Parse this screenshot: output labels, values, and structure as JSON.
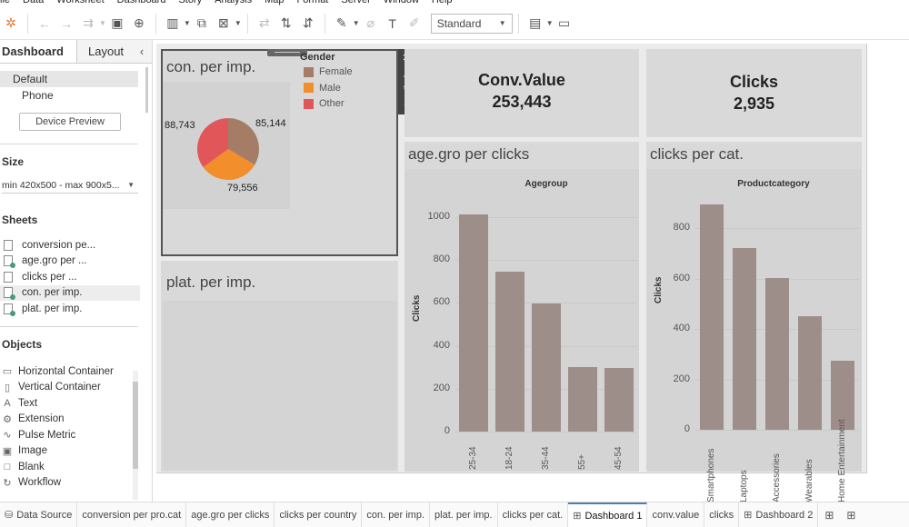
{
  "menu": [
    "ile",
    "Data",
    "Worksheet",
    "Dashboard",
    "Story",
    "Analysis",
    "Map",
    "Format",
    "Server",
    "Window",
    "Help"
  ],
  "toolbar": {
    "fit_select": "Standard"
  },
  "sidebar": {
    "tabs": {
      "dashboard": "Dashboard",
      "layout": "Layout"
    },
    "devices": [
      "Default",
      "Phone"
    ],
    "device_preview": "Device Preview",
    "size_title": "Size",
    "size_value": "min 420x500 - max 900x5...",
    "sheets_title": "Sheets",
    "sheets": [
      {
        "label": "conversion pe...",
        "used": false
      },
      {
        "label": "age.gro per ...",
        "used": true
      },
      {
        "label": "clicks per ...",
        "used": false
      },
      {
        "label": "con. per imp.",
        "used": true
      },
      {
        "label": "plat. per imp.",
        "used": true
      },
      {
        "label": "clicks per cat.",
        "used": true
      }
    ],
    "objects_title": "Objects",
    "objects": [
      {
        "label": "Horizontal Container",
        "icon": "horizontal-container-icon",
        "glyph": "▭"
      },
      {
        "label": "Vertical Container",
        "icon": "vertical-container-icon",
        "glyph": "▯"
      },
      {
        "label": "Text",
        "icon": "text-icon",
        "glyph": "A"
      },
      {
        "label": "Extension",
        "icon": "extension-icon",
        "glyph": "⚙"
      },
      {
        "label": "Pulse Metric",
        "icon": "pulse-metric-icon",
        "glyph": "∿"
      },
      {
        "label": "Image",
        "icon": "image-icon",
        "glyph": "▣"
      },
      {
        "label": "Blank",
        "icon": "blank-icon",
        "glyph": "□"
      },
      {
        "label": "Workflow",
        "icon": "workflow-icon",
        "glyph": "↻"
      }
    ]
  },
  "dashboard": {
    "pie_panel": {
      "title": "con. per imp.",
      "legend_title": "Gender",
      "legend": [
        {
          "label": "Female",
          "color": "#a57c66"
        },
        {
          "label": "Male",
          "color": "#f28e2b"
        },
        {
          "label": "Other",
          "color": "#e15759"
        }
      ],
      "labels": {
        "female": "85,144",
        "male": "79,556",
        "other": "88,743"
      }
    },
    "plat_panel": {
      "title": "plat. per imp."
    },
    "conv_kpi": {
      "title": "Conv.Value",
      "value": "253,443"
    },
    "clicks_kpi": {
      "title": "Clicks",
      "value": "2,935"
    },
    "age_panel": {
      "title": "age.gro per clicks",
      "header": "Agegroup",
      "ylabel": "Clicks"
    },
    "cat_panel": {
      "title": "clicks per cat.",
      "header": "Productcategory",
      "ylabel": "Clicks"
    }
  },
  "chart_data": [
    {
      "type": "pie",
      "categories": [
        "Female",
        "Male",
        "Other"
      ],
      "values": [
        85144,
        79556,
        88743
      ],
      "legend": "Gender"
    },
    {
      "type": "bar",
      "title": "Agegroup",
      "ylabel": "Clicks",
      "categories": [
        "25-34",
        "18-24",
        "35-44",
        "55+",
        "45-54"
      ],
      "values": [
        1012,
        745,
        597,
        300,
        295
      ],
      "ylim": [
        0,
        1080
      ],
      "yticks": [
        0,
        200,
        400,
        600,
        800,
        1000
      ]
    },
    {
      "type": "bar",
      "title": "Productcategory",
      "ylabel": "Clicks",
      "categories": [
        "Smartphones",
        "Laptops",
        "Accessories",
        "Wearables",
        "Home Entertainment"
      ],
      "values": [
        895,
        720,
        602,
        452,
        275
      ],
      "ylim": [
        0,
        920
      ],
      "yticks": [
        0,
        200,
        400,
        600,
        800
      ]
    }
  ],
  "bottom_tabs": [
    {
      "label": "Data Source",
      "icon": "database-icon",
      "active": false
    },
    {
      "label": "conversion per pro.cat",
      "active": false
    },
    {
      "label": "age.gro per clicks",
      "active": false
    },
    {
      "label": "clicks per country",
      "active": false
    },
    {
      "label": "con. per imp.",
      "active": false
    },
    {
      "label": "plat. per imp.",
      "active": false
    },
    {
      "label": "clicks per cat.",
      "active": false
    },
    {
      "label": "Dashboard 1",
      "icon": "dashboard-icon",
      "active": true
    },
    {
      "label": "conv.value",
      "active": false
    },
    {
      "label": "clicks",
      "active": false
    },
    {
      "label": "Dashboard 2",
      "icon": "dashboard-icon",
      "active": false
    }
  ]
}
